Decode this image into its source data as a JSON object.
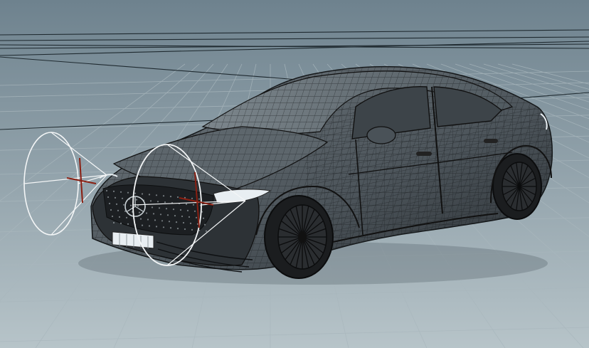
{
  "viewport": {
    "background_top": "#6e828e",
    "background_bottom": "#b7c4c9",
    "grid_color": "#a9b7bd",
    "horizon_line_color": "#1f2a30"
  },
  "scene": {
    "model": {
      "kind": "sedan-wireframe",
      "body_fill": "#5b6369",
      "wire_color": "#1a1d20",
      "wheel_fill": "#1b1d1f",
      "light_strip_color": "#e8eef2"
    },
    "lights": [
      {
        "kind": "spot-light-gizmo",
        "gizmo_color": "#f4f6f7",
        "handle_color": "#8a1f12"
      },
      {
        "kind": "spot-light-gizmo",
        "gizmo_color": "#f4f6f7",
        "handle_color": "#8a1f12"
      }
    ]
  }
}
